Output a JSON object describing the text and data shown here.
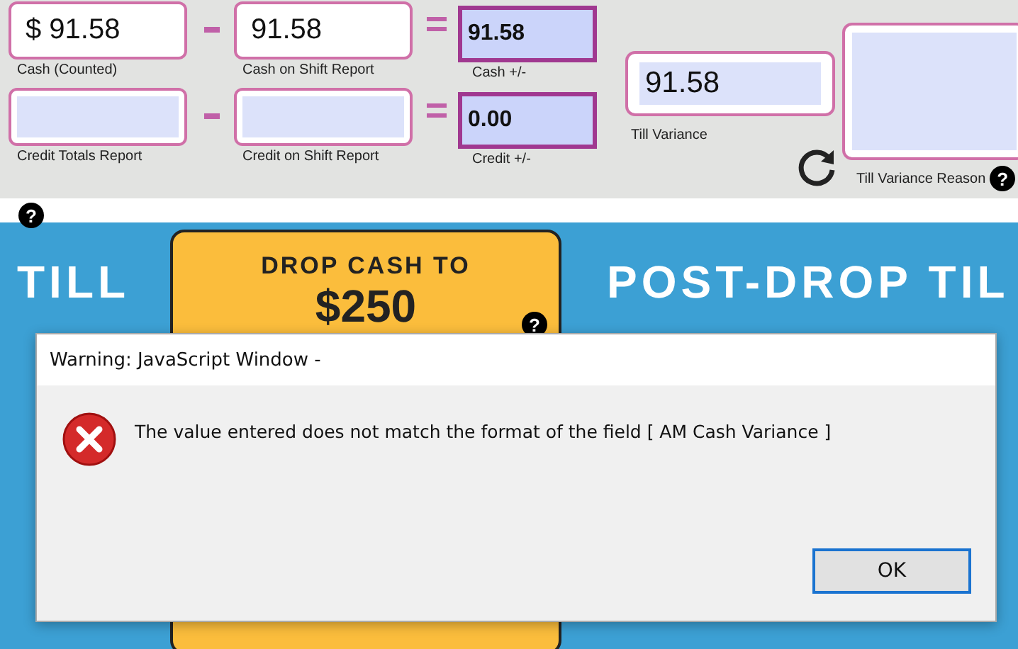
{
  "reconcile_rows": [
    {
      "left": {
        "value": "$ 91.58",
        "label": "Cash (Counted)"
      },
      "right": {
        "value": "91.58",
        "label": "Cash on Shift Report"
      },
      "result": {
        "value": "91.58",
        "label": "Cash +/-"
      }
    },
    {
      "left": {
        "label": "Credit Totals Report"
      },
      "right": {
        "label": "Credit on Shift Report"
      },
      "result": {
        "value": "0.00",
        "label": "Credit +/-"
      }
    }
  ],
  "till_variance": {
    "value": "91.58",
    "label": "Till Variance"
  },
  "till_variance_reason": {
    "label": "Till Variance Reason",
    "help": "?"
  },
  "banner": {
    "help": "?",
    "left_title": "TILL",
    "drop_help": "?",
    "drop_line": "DROP CASH TO",
    "drop_amount": "$250",
    "right_title": "POST-DROP TIL"
  },
  "dialog": {
    "title": "Warning: JavaScript Window -",
    "message": "The value entered does not match the format of the field [ AM Cash Variance ]",
    "button": "OK"
  }
}
